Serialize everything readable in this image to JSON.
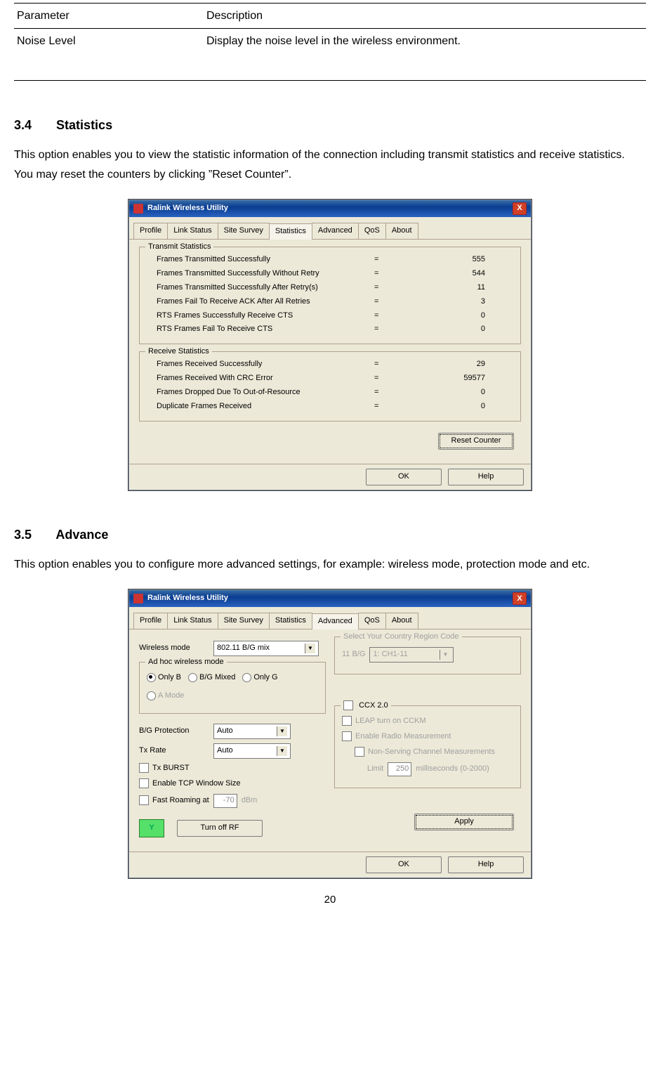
{
  "defTable": {
    "headers": [
      "Parameter",
      "Description"
    ],
    "row": {
      "param": "Noise Level",
      "desc": "Display the noise level in the wireless environment."
    }
  },
  "sec34": {
    "num": "3.4",
    "title": "Statistics",
    "para": "This option enables you to view the statistic information of the connection including transmit statistics and receive statistics. You may reset the counters by clicking ”Reset Counter”."
  },
  "sec35": {
    "num": "3.5",
    "title": "Advance",
    "para": "This option enables you to configure more advanced settings, for example: wireless mode, protection mode and etc."
  },
  "win": {
    "title": "Ralink Wireless Utility",
    "close": "X"
  },
  "tabs": {
    "profile": "Profile",
    "link": "Link Status",
    "site": "Site Survey",
    "stats": "Statistics",
    "adv": "Advanced",
    "qos": "QoS",
    "about": "About"
  },
  "stats": {
    "txTitle": "Transmit Statistics",
    "rxTitle": "Receive Statistics",
    "tx": [
      {
        "l": "Frames Transmitted Successfully",
        "v": "555"
      },
      {
        "l": "Frames Transmitted Successfully  Without Retry",
        "v": "544"
      },
      {
        "l": "Frames Transmitted Successfully After Retry(s)",
        "v": "11"
      },
      {
        "l": "Frames Fail To Receive ACK After All Retries",
        "v": "3"
      },
      {
        "l": "RTS Frames Successfully Receive CTS",
        "v": "0"
      },
      {
        "l": "RTS Frames Fail To Receive CTS",
        "v": "0"
      }
    ],
    "rx": [
      {
        "l": "Frames Received Successfully",
        "v": "29"
      },
      {
        "l": "Frames Received With CRC Error",
        "v": "59577"
      },
      {
        "l": "Frames Dropped Due To Out-of-Resource",
        "v": "0"
      },
      {
        "l": "Duplicate Frames Received",
        "v": "0"
      }
    ],
    "reset": "Reset Counter",
    "ok": "OK",
    "help": "Help"
  },
  "adv": {
    "wirelessModeLbl": "Wireless mode",
    "wirelessModeVal": "802.11 B/G mix",
    "adhocTitle": "Ad hoc wireless mode",
    "adhoc": {
      "onlyB": "Only B",
      "bgmix": "B/G Mixed",
      "onlyG": "Only G",
      "amode": "A Mode"
    },
    "bgProtLbl": "B/G Protection",
    "bgProtVal": "Auto",
    "txRateLbl": "Tx Rate",
    "txRateVal": "Auto",
    "txBurst": "Tx BURST",
    "tcpWin": "Enable TCP Window Size",
    "fastRoam": "Fast Roaming at",
    "fastRoamVal": "-70",
    "dbm": "dBm",
    "country": {
      "title": "Select Your Country Region Code",
      "band": "11 B/G",
      "ch": "1: CH1-11"
    },
    "ccxTitle": "CCX 2.0",
    "ccx": {
      "leap": "LEAP turn on CCKM",
      "radio": "Enable Radio Measurement",
      "nonserv": "Non-Serving Channel Measurements",
      "limit": "Limit",
      "limitVal": "250",
      "limitUnit": "milliseconds (0-2000)"
    },
    "turnOff": "Turn off RF",
    "apply": "Apply",
    "ok": "OK",
    "help": "Help"
  },
  "pageNumber": "20"
}
